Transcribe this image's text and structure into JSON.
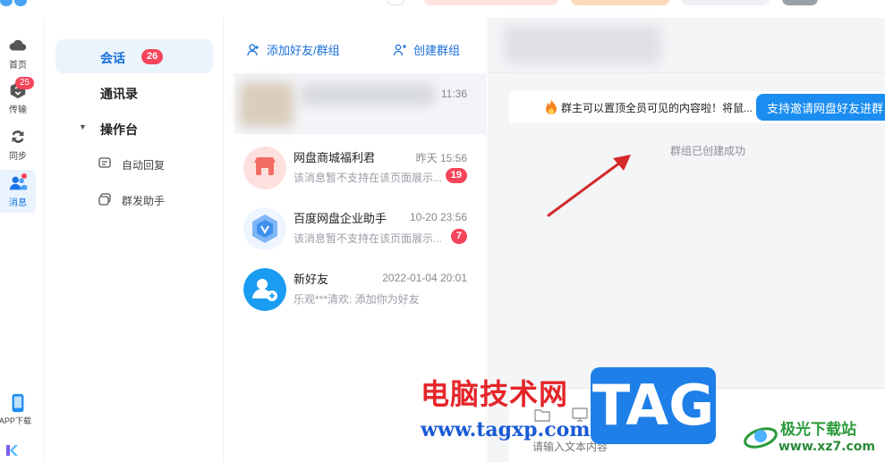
{
  "rail": {
    "items": [
      {
        "label": "首页",
        "icon": "cloud-home-icon"
      },
      {
        "label": "传输",
        "icon": "transfer-icon",
        "badge": "25"
      },
      {
        "label": "同步",
        "icon": "sync-icon"
      },
      {
        "label": "消息",
        "icon": "messages-icon",
        "active": true
      },
      {
        "label": "APP下载",
        "icon": "phone-icon"
      }
    ]
  },
  "nav": {
    "conversations": {
      "label": "会话",
      "badge": "26"
    },
    "contacts": {
      "label": "通讯录"
    },
    "workbench": {
      "label": "操作台"
    },
    "auto_reply": {
      "label": "自动回复"
    },
    "mass_send": {
      "label": "群发助手"
    }
  },
  "conv_actions": {
    "add_friend": "添加好友/群组",
    "create_group": "创建群组"
  },
  "conversations": [
    {
      "name": "",
      "time": "11:36",
      "preview": "",
      "blurred": true
    },
    {
      "name": "网盘商城福利君",
      "time": "昨天 15:56",
      "preview": "该消息暂不支持在该页面展示...",
      "badge": "19"
    },
    {
      "name": "百度网盘企业助手",
      "time": "10-20 23:56",
      "preview": "该消息暂不支持在该页面展示...",
      "badge": "7"
    },
    {
      "name": "新好友",
      "time": "2022-01-04 20:01",
      "preview": "乐观***清欢: 添加你为好友"
    }
  ],
  "chat": {
    "notice_text": "群主可以置顶全员可见的内容啦！将鼠...",
    "invite_button": "支持邀请网盘好友进群",
    "system_message": "群组已创建成功",
    "input_placeholder": "请输入文本内容"
  },
  "watermarks": {
    "site_name": "电脑技术网",
    "site_url": "www.tagxp.com",
    "tag_logo": "TAG",
    "aurora_name": "极光下载站",
    "aurora_url": "www.xz7.com"
  },
  "colors": {
    "accent": "#1a6fd8",
    "badge": "#f5455b",
    "invite_button": "#1b8df0",
    "arrow": "#d42a2a"
  }
}
